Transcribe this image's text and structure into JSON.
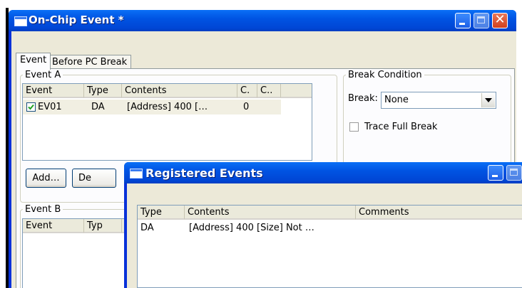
{
  "main_window": {
    "title": "On-Chip Event *",
    "tabs": [
      {
        "label": "Event"
      },
      {
        "label": "Before PC Break"
      }
    ],
    "event_a": {
      "title": "Event A",
      "columns": [
        "Event",
        "Type",
        "Contents",
        "C.",
        "C.."
      ],
      "rows": [
        {
          "event": "EV01",
          "type": "DA",
          "contents": "[Address] 400 […",
          "c": "0",
          "checked": true
        }
      ],
      "buttons": {
        "add": "Add…",
        "delete": "De"
      }
    },
    "break_condition": {
      "title": "Break Condition",
      "break_label": "Break:",
      "break_value": "None",
      "trace_full_break": "Trace Full Break"
    },
    "event_b": {
      "title": "Event B",
      "columns": [
        "Event",
        "Typ"
      ]
    }
  },
  "registered_events": {
    "title": "Registered Events",
    "columns": [
      "Type",
      "Contents",
      "Comments"
    ],
    "rows": [
      {
        "type": "DA",
        "contents": "[Address] 400 [Size] Not …",
        "comments": ""
      }
    ]
  },
  "colors": {
    "titlebar": "#0054e3",
    "face": "#ece9d8",
    "panel": "#fcfcfe"
  }
}
